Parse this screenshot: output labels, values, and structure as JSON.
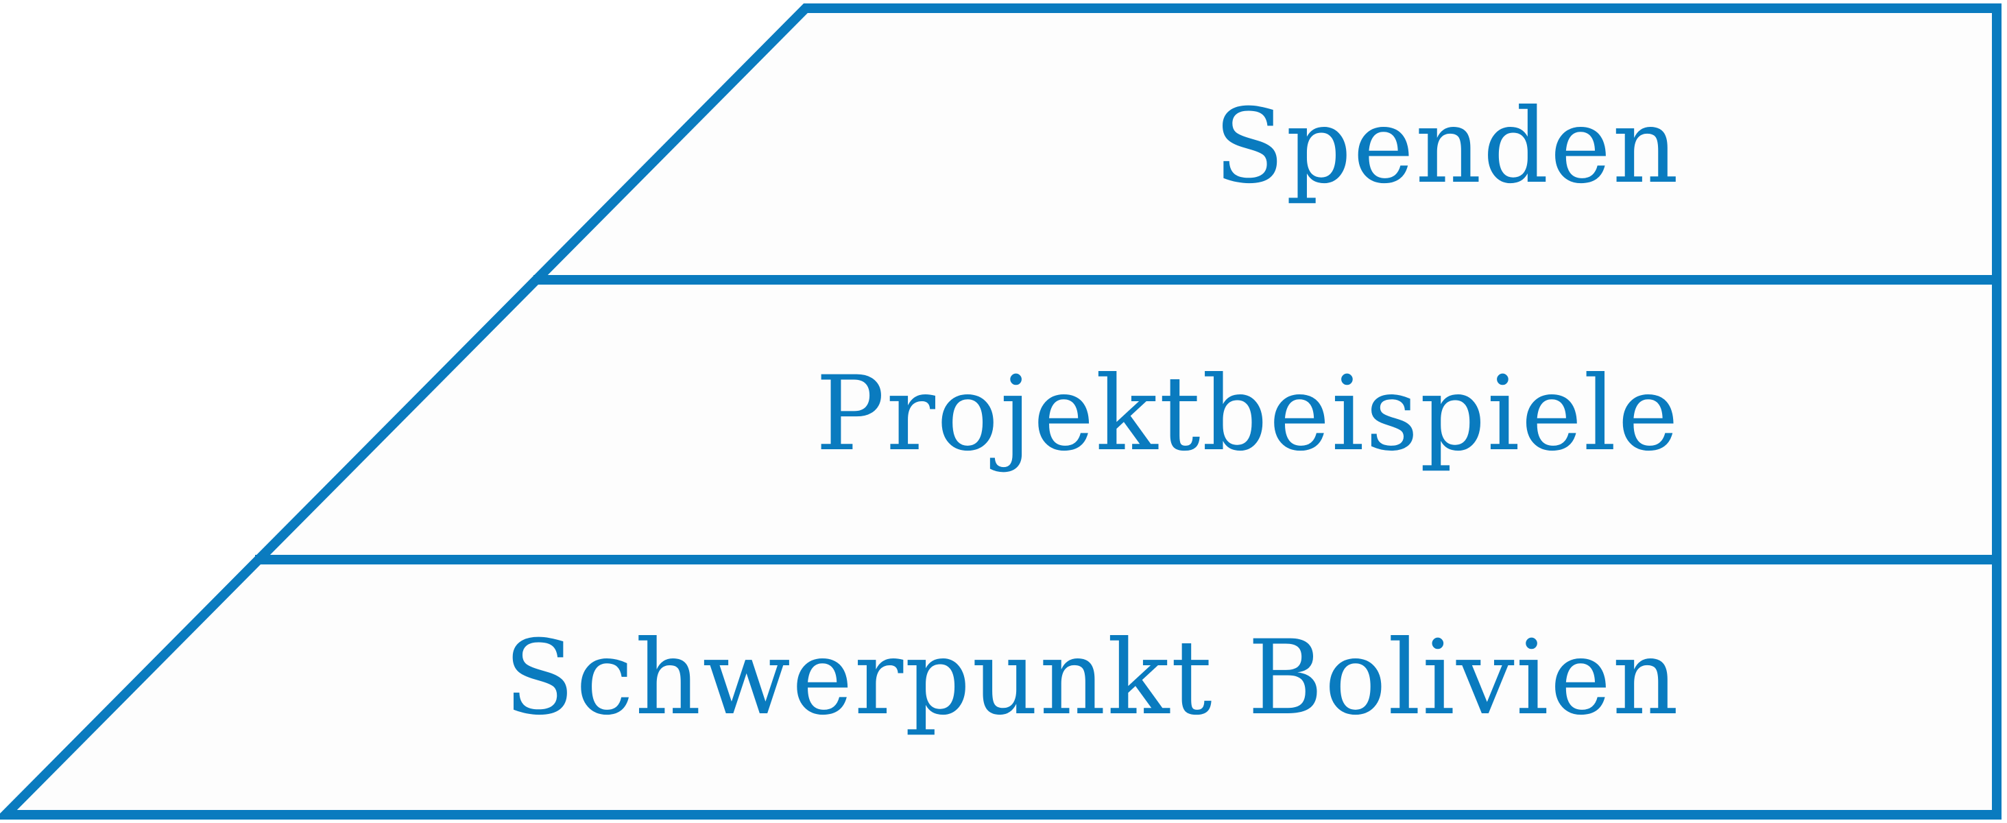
{
  "diagram": {
    "colors": {
      "outline": "#0a7bbf",
      "text": "#0a7bbf",
      "fill": "#fdfdfd"
    },
    "levels": [
      {
        "label": "Spenden"
      },
      {
        "label": "Projektbeispiele"
      },
      {
        "label": "Schwerpunkt Bolivien"
      }
    ]
  }
}
